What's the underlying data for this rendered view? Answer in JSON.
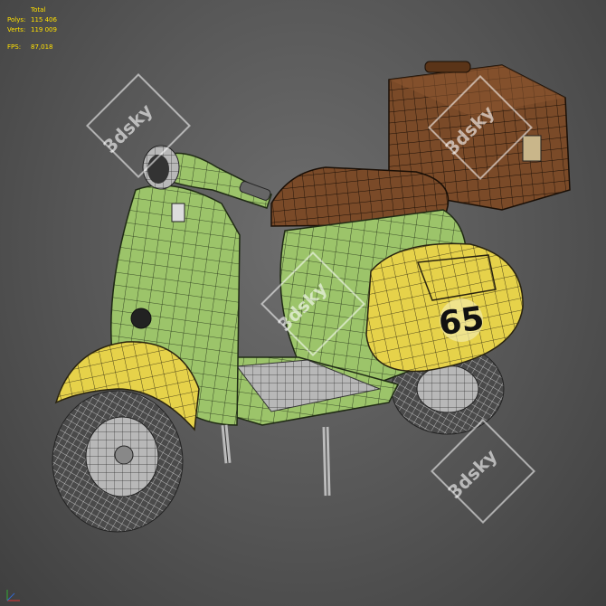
{
  "stats": {
    "total_label": "Total",
    "polys_label": "Polys:",
    "polys_value": "115 406",
    "verts_label": "Verts:",
    "verts_value": "119 009",
    "fps_label": "FPS:",
    "fps_value": "87,018"
  },
  "watermark": "3dsky",
  "number_plate": "65",
  "colors": {
    "background": "#555555",
    "body_green": "#9cc46a",
    "fender_yellow": "#e6d24a",
    "leather_brown": "#7a4a28",
    "wire": "#1a1a1a",
    "stats_text": "#ffe000"
  }
}
